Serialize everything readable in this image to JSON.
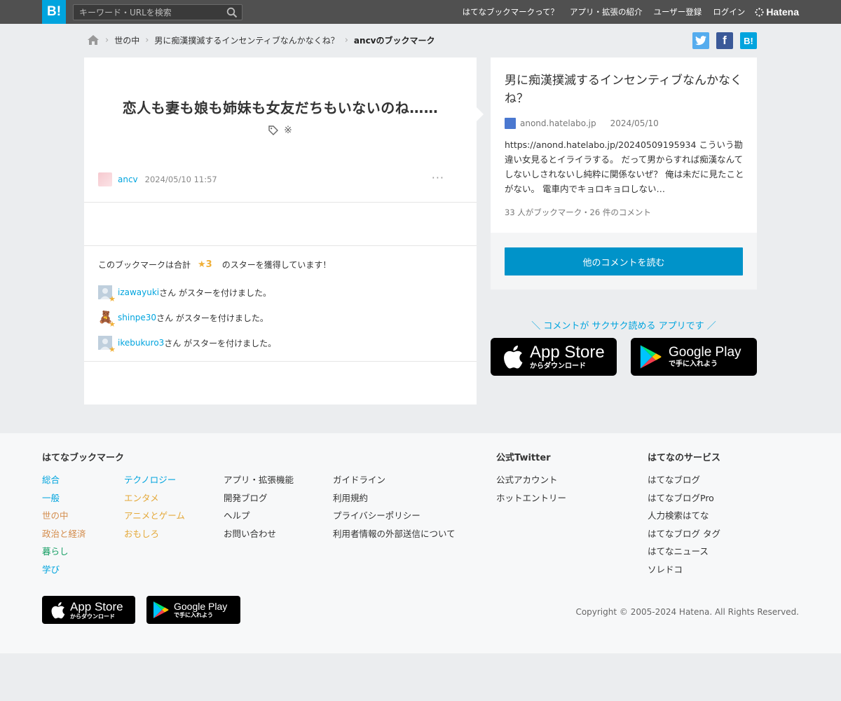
{
  "header": {
    "logo": "B!",
    "search_placeholder": "キーワード・URLを検索",
    "nav": [
      "はてなブックマークって？",
      "アプリ・拡張の紹介",
      "ユーザー登録",
      "ログイン"
    ],
    "hatena_logo": "Hatena"
  },
  "breadcrumb": {
    "items": [
      "世の中",
      "男に痴漢撲滅するインセンティブなんかなくね？"
    ],
    "current": "ancvのブックマーク"
  },
  "share": {
    "facebook": "f",
    "hatena": "B!"
  },
  "bookmark": {
    "comment": "恋人も妻も娘も姉妹も女友だちもいないのね……",
    "tag": "※",
    "user": "ancv",
    "date": "2024/05/10 11:57",
    "more": "···"
  },
  "stars": {
    "summary_prefix": "このブックマークは合計",
    "total": "★3",
    "summary_suffix": "のスターを獲得しています！",
    "suffix": "さん がスターを付けました。",
    "users": [
      "izawayuki",
      "shinpe30",
      "ikebukuro3"
    ]
  },
  "entry": {
    "title": "男に痴漢撲滅するインセンティブなんかなくね？",
    "domain": "anond.hatelabo.jp",
    "date": "2024/05/10",
    "description": "https://anond.hatelabo.jp/20240509195934 こういう勘違い女見るとイライラする。 だって男からすれば痴漢なんてしないしされないし純粋に関係ないぜ？ 俺は未だに見たことがない。 電車内でキョロキョロしない…",
    "count": "33 人がブックマーク・26 件のコメント",
    "read_more": "他のコメントを読む"
  },
  "app_promo": {
    "text": "＼ コメントが サクサク読める アプリです ／",
    "appstore_big": "App Store",
    "appstore_small": "からダウンロード",
    "googleplay_big": "Google Play",
    "googleplay_small": "で手に入れよう"
  },
  "footer": {
    "bookmark_head": "はてなブックマーク",
    "categories_col1": [
      "総合",
      "一般",
      "世の中",
      "政治と経済",
      "暮らし",
      "学び"
    ],
    "categories_col2": [
      "テクノロジー",
      "エンタメ",
      "アニメとゲーム",
      "おもしろ"
    ],
    "links_col3": [
      "アプリ・拡張機能",
      "開発ブログ",
      "ヘルプ",
      "お問い合わせ"
    ],
    "links_col4": [
      "ガイドライン",
      "利用規約",
      "プライバシーポリシー",
      "利用者情報の外部送信について"
    ],
    "twitter_head": "公式Twitter",
    "twitter_links": [
      "公式アカウント",
      "ホットエントリー"
    ],
    "services_head": "はてなのサービス",
    "services": [
      "はてなブログ",
      "はてなブログPro",
      "人力検索はてな",
      "はてなブログ タグ",
      "はてなニュース",
      "ソレドコ"
    ],
    "copyright": "Copyright © 2005-2024 Hatena. All Rights Reserved."
  }
}
